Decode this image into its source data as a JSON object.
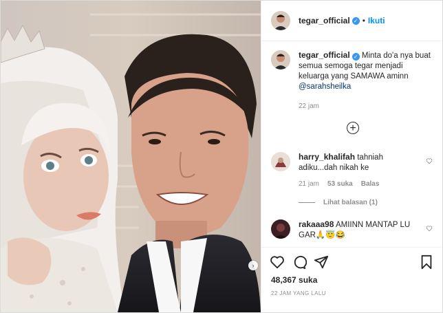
{
  "post": {
    "username": "tegar_official",
    "separator": "•",
    "follow_label": "Ikuti"
  },
  "caption": {
    "username": "tegar_official",
    "text": " Minta do'a nya buat semua semoga tegar menjadi keluarga yang SAMAWA aminn ",
    "mention": "@sarahsheilka",
    "time": "22 jam"
  },
  "load_more_icon": "plus-circle-icon",
  "comments": [
    {
      "username": "harry_khalifah",
      "text": " tahniah adiku...dah nikah ke",
      "time": "21 jam",
      "likes": "53 suka",
      "reply_label": "Balas",
      "view_replies": "Lihat balasan (1)"
    },
    {
      "username": "rakaaa98",
      "text": " AMIINN MANTAP LU GAR🙏😇😂"
    }
  ],
  "footer": {
    "likes": "48,367 suka",
    "time_ago": "22 JAM YANG LALU"
  },
  "colors": {
    "link": "#0095f6",
    "mention": "#00376b",
    "verified": "#3897f0",
    "meta": "#8e8e8e"
  }
}
